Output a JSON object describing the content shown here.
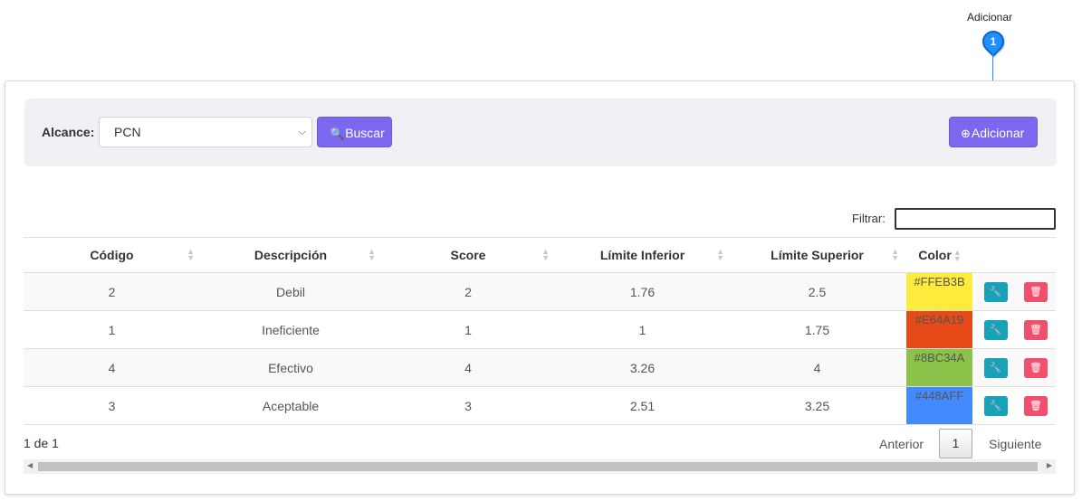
{
  "callout": {
    "label": "Adicionar",
    "number": "1"
  },
  "filters": {
    "alcance_label": "Alcance:",
    "alcance_value": "PCN",
    "buscar_label": "Buscar",
    "adicionar_label": "Adicionar"
  },
  "search": {
    "label": "Filtrar:",
    "value": ""
  },
  "table": {
    "headers": [
      "Código",
      "Descripción",
      "Score",
      "Límite Inferior",
      "Límite Superior",
      "Color"
    ],
    "rows": [
      {
        "codigo": "2",
        "descripcion": "Debil",
        "score": "2",
        "inferior": "1.76",
        "superior": "2.5",
        "color": "#FFEB3B"
      },
      {
        "codigo": "1",
        "descripcion": "Ineficiente",
        "score": "1",
        "inferior": "1",
        "superior": "1.75",
        "color": "#E64A19"
      },
      {
        "codigo": "4",
        "descripcion": "Efectivo",
        "score": "4",
        "inferior": "3.26",
        "superior": "4",
        "color": "#8BC34A"
      },
      {
        "codigo": "3",
        "descripcion": "Aceptable",
        "score": "3",
        "inferior": "2.51",
        "superior": "3.25",
        "color": "#448AFF"
      }
    ]
  },
  "pagination": {
    "info": "1 de 1",
    "prev": "Anterior",
    "page": "1",
    "next": "Siguiente"
  },
  "icons": {
    "buscar": "search-icon",
    "adicionar": "plus-circle-icon",
    "edit": "wrench-icon",
    "delete": "trash-icon"
  }
}
